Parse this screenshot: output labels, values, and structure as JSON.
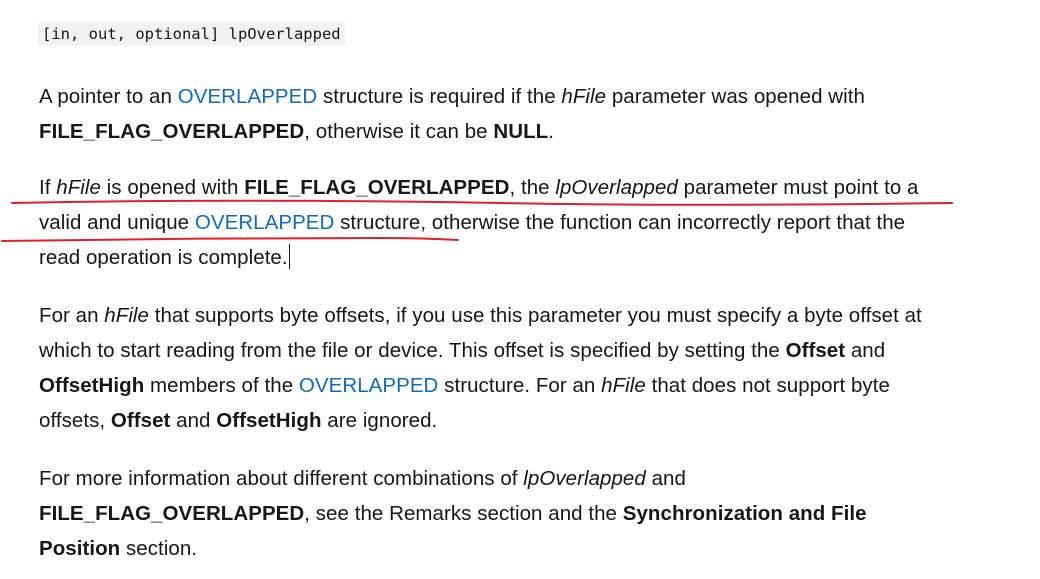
{
  "param_signature": "[in, out, optional] lpOverlapped",
  "para1": {
    "t1": "A pointer to an ",
    "link1": "OVERLAPPED",
    "t2": " structure is required if the ",
    "i1": "hFile",
    "t3": " parameter was opened with ",
    "b1": "FILE_FLAG_OVERLAPPED",
    "t4": ", otherwise it can be ",
    "b2": "NULL",
    "t5": "."
  },
  "para2": {
    "t1": "If ",
    "i1": "hFile",
    "t2": " is opened with ",
    "b1": "FILE_FLAG_OVERLAPPED",
    "t3": ", the ",
    "i2": "lpOverlapped",
    "t4": " parameter must point to a valid and unique ",
    "link1": "OVERLAPPED",
    "t5": " structure, otherwise the function can incorrectly report that the read operation is complete."
  },
  "para3": {
    "t1": "For an ",
    "i1": "hFile",
    "t2": " that supports byte offsets, if you use this parameter you must specify a byte offset at which to start reading from the file or device. This offset is specified by setting the ",
    "b1": "Offset",
    "t3": " and ",
    "b2": "OffsetHigh",
    "t4": " members of the ",
    "link1": "OVERLAPPED",
    "t5": " structure. For an ",
    "i2": "hFile",
    "t6": " that does not support byte offsets, ",
    "b3": "Offset",
    "t7": " and ",
    "b4": "OffsetHigh",
    "t8": " are ignored."
  },
  "para4": {
    "t1": "For more information about different combinations of ",
    "i1": "lpOverlapped",
    "t2": " and ",
    "b1": "FILE_FLAG_OVERLAPPED",
    "t3": ", see the Remarks section and the ",
    "b2": "Synchronization and File Position",
    "t4": " section."
  },
  "annotation_color": "#e0202a",
  "link_color": "#0f6cbd"
}
